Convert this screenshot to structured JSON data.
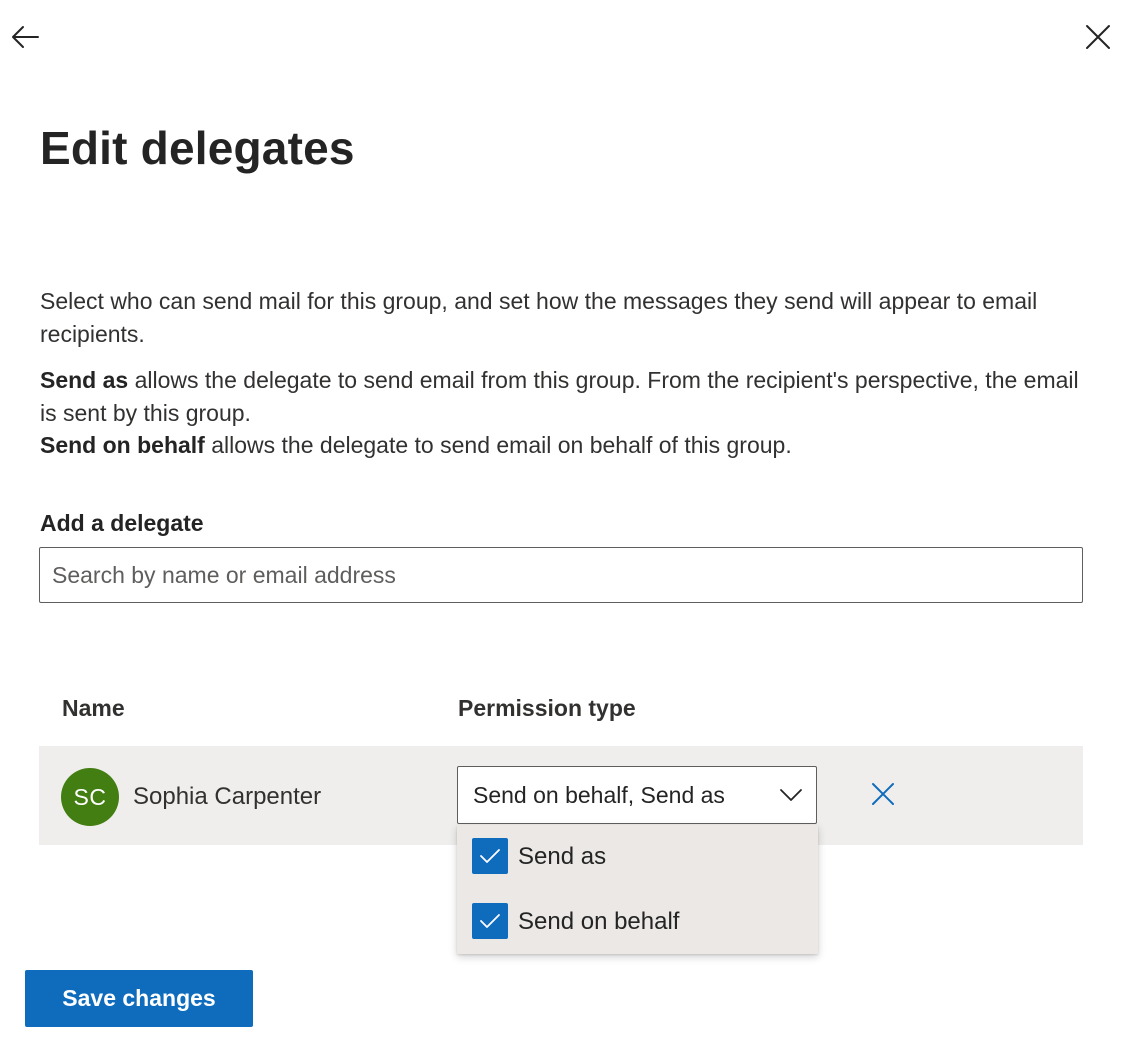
{
  "header": {
    "back_icon": "arrow-left-icon",
    "close_icon": "close-icon",
    "title": "Edit delegates"
  },
  "description": {
    "intro": "Select who can send mail for this group, and set how the messages they send will appear to email recipients.",
    "send_as_term": "Send as",
    "send_as_text": " allows the delegate to send email from this group. From the recipient's perspective, the email is sent by this group.",
    "send_on_behalf_term": "Send on behalf",
    "send_on_behalf_text": " allows the delegate to send email on behalf of this group."
  },
  "add_delegate": {
    "label": "Add a delegate",
    "placeholder": "Search by name or email address",
    "value": ""
  },
  "table": {
    "columns": [
      "Name",
      "Permission type"
    ],
    "rows": [
      {
        "initials": "SC",
        "name": "Sophia Carpenter",
        "permission": "Send on behalf, Send as",
        "avatar_color": "#437e12"
      }
    ]
  },
  "permission_menu": {
    "options": [
      {
        "label": "Send as",
        "checked": true
      },
      {
        "label": "Send on behalf",
        "checked": true
      }
    ]
  },
  "footer": {
    "save_label": "Save changes"
  },
  "colors": {
    "accent": "#0f6cbd",
    "row_background": "#efeeec",
    "menu_background": "#ebe8e5"
  }
}
